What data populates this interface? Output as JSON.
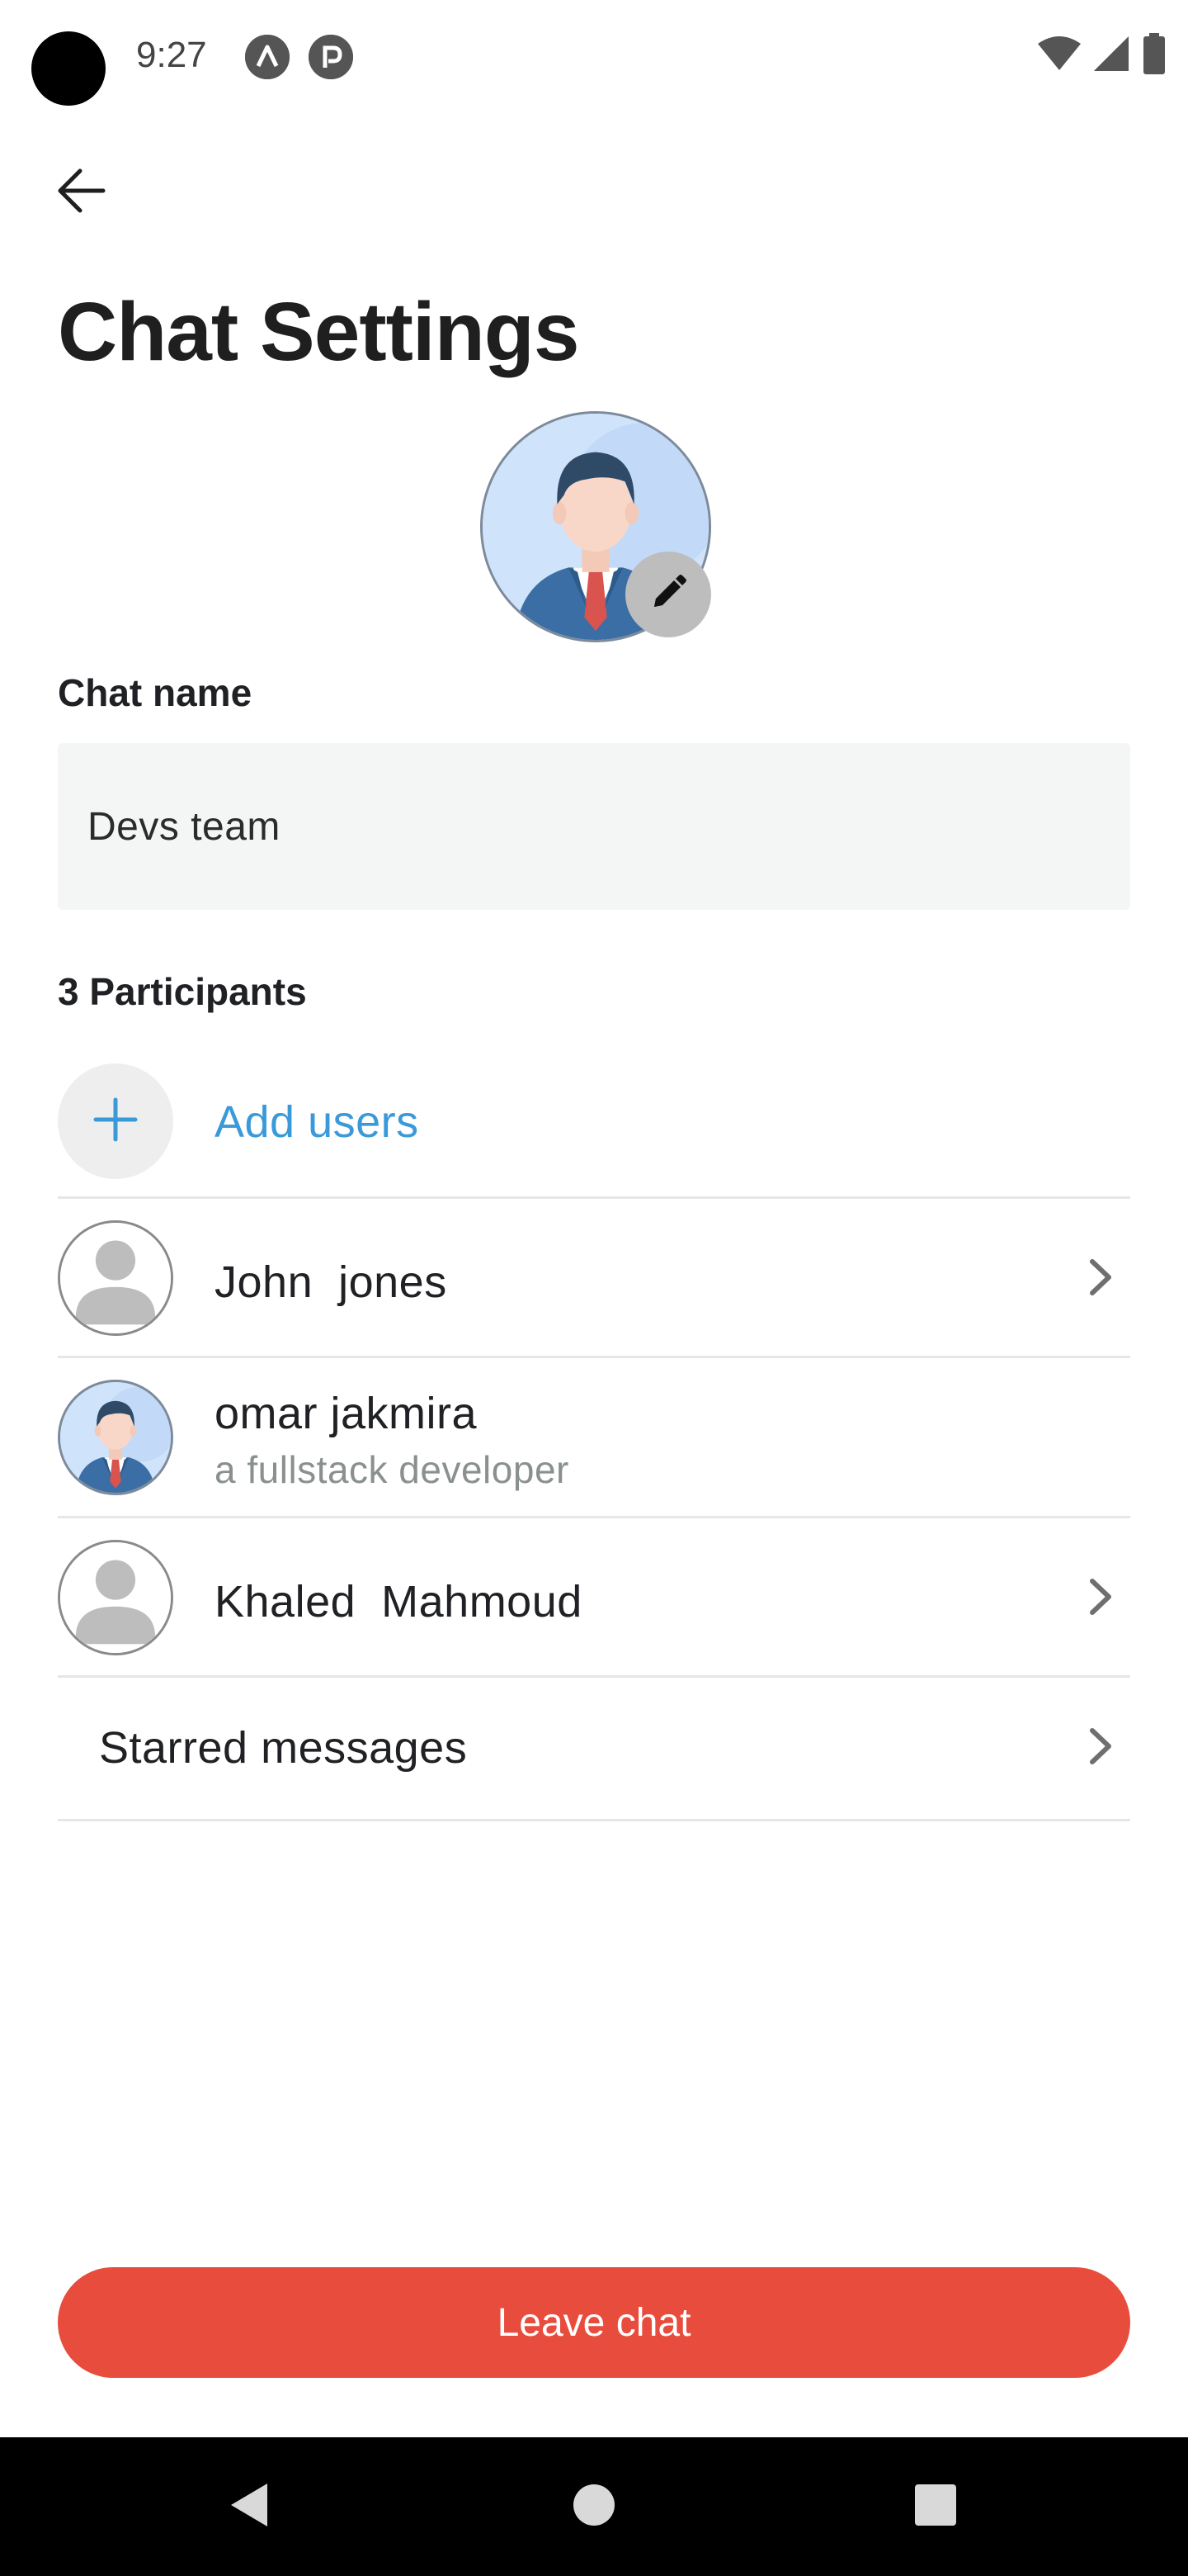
{
  "status_bar": {
    "time": "9:27",
    "icons": [
      "notification-a-icon",
      "notification-p-icon",
      "wifi-icon",
      "signal-icon",
      "battery-icon"
    ]
  },
  "header": {
    "back_icon": "arrow-left-icon",
    "title": "Chat Settings"
  },
  "group_avatar": {
    "image": "businessman-avatar",
    "edit_icon": "pencil-icon"
  },
  "chat_name": {
    "label": "Chat name",
    "value": "Devs team"
  },
  "participants": {
    "label": "3 Participants",
    "add_users_label": "Add users",
    "members": [
      {
        "name": "John  jones",
        "subtitle": "",
        "avatar": "generic-person-icon",
        "has_chevron": true
      },
      {
        "name": "omar jakmira",
        "subtitle": "a fullstack developer",
        "avatar": "businessman-avatar",
        "has_chevron": false
      },
      {
        "name": "Khaled  Mahmoud",
        "subtitle": "",
        "avatar": "generic-person-icon",
        "has_chevron": true
      }
    ]
  },
  "starred": {
    "label": "Starred messages"
  },
  "leave_button": {
    "label": "Leave chat"
  },
  "colors": {
    "accent_blue": "#3a9ad9",
    "danger_red": "#e84c3d",
    "field_background": "#f3f6f5",
    "divider": "#e6e6e6"
  }
}
